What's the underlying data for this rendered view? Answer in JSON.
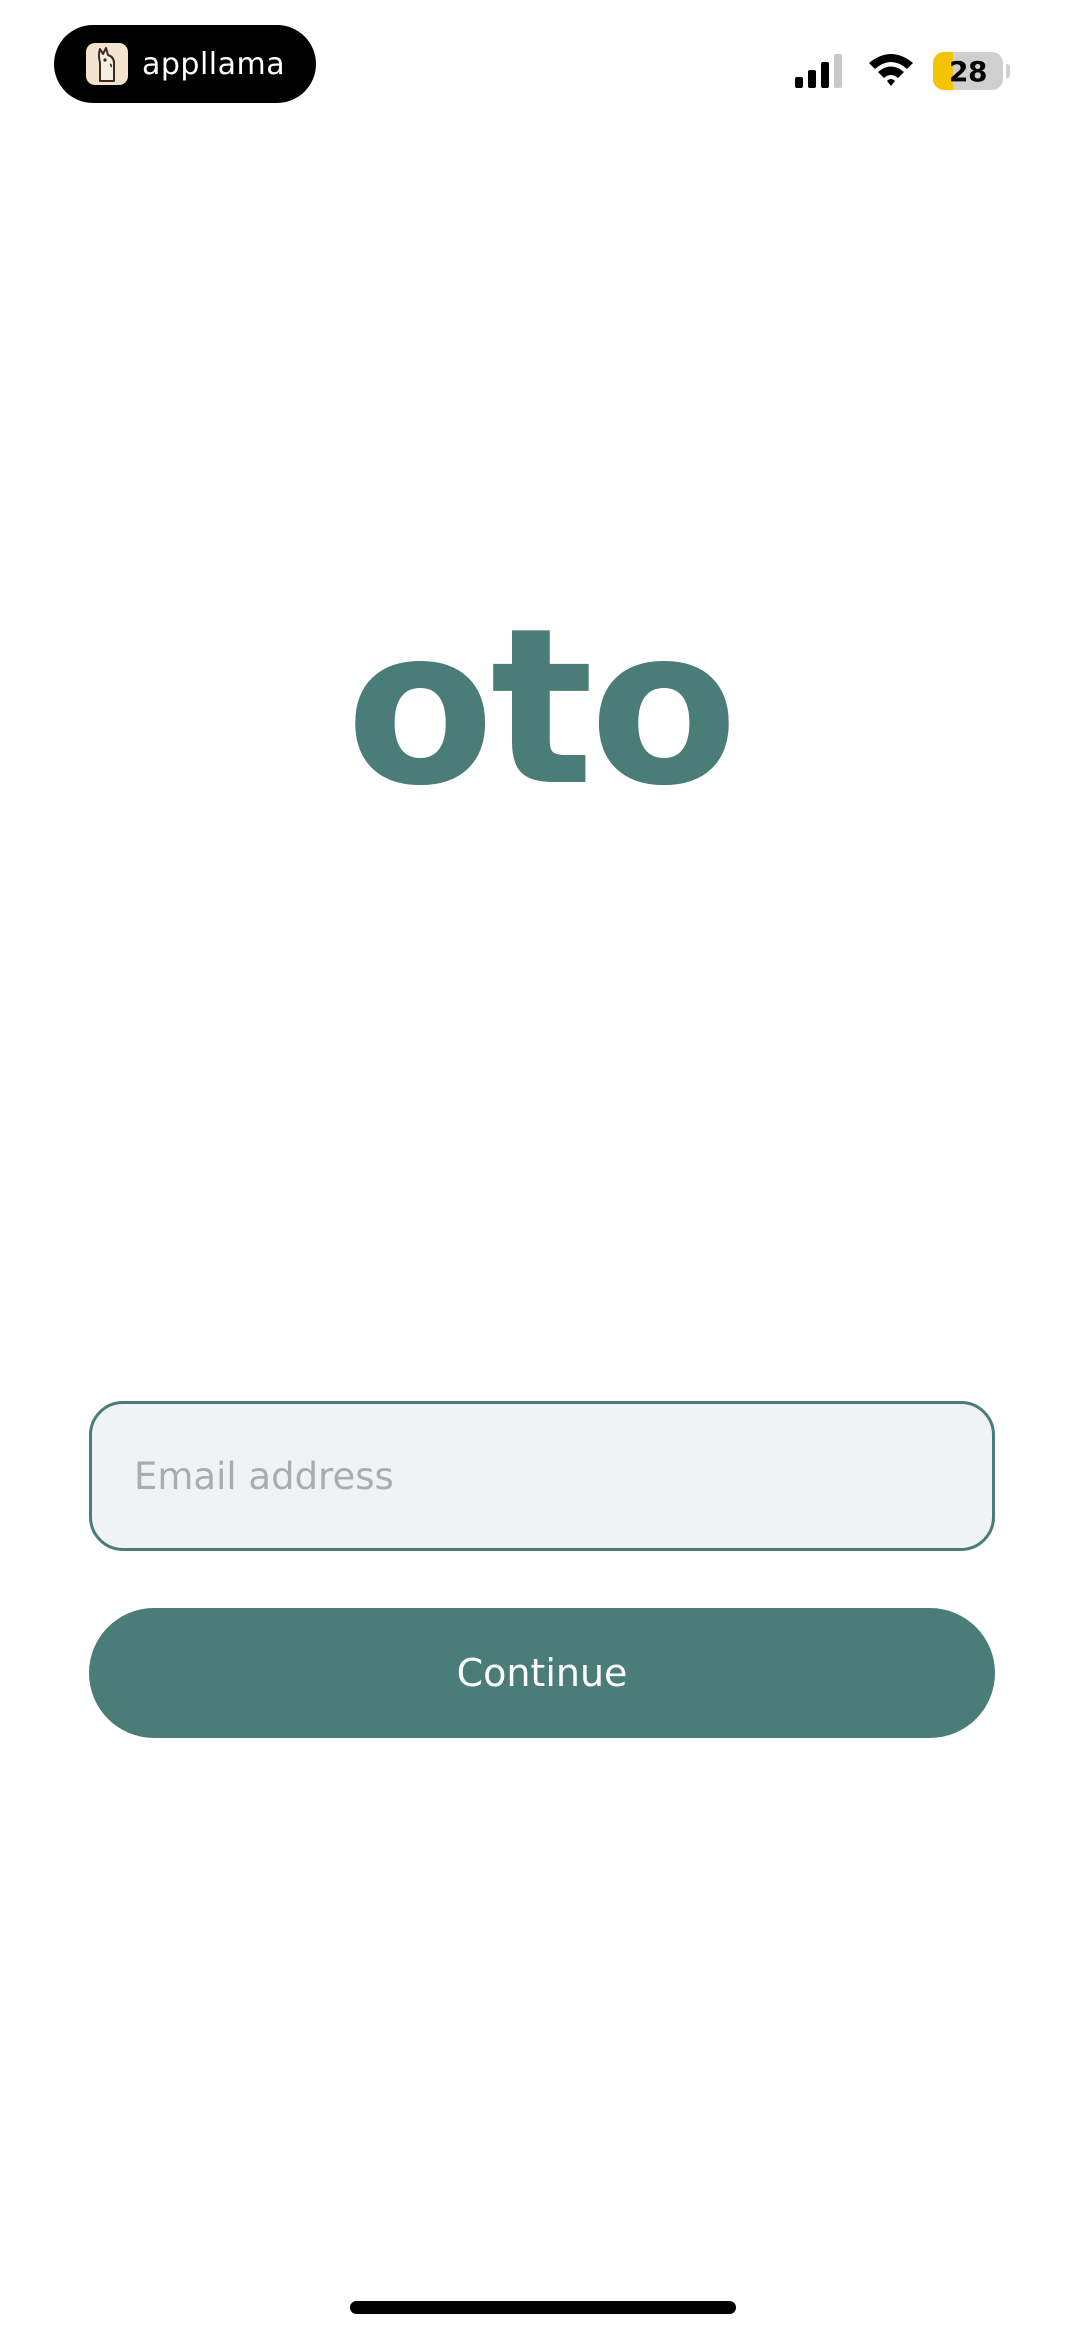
{
  "status_bar": {
    "app_pill_label": "appllama",
    "battery_level": "28",
    "battery_fraction": 0.28,
    "icons": [
      "llama-icon",
      "cellular-signal-icon",
      "wifi-icon",
      "battery-icon"
    ]
  },
  "brand": {
    "logo_text": "oto",
    "accent_color": "#4a7c78"
  },
  "login": {
    "email_placeholder": "Email address",
    "email_value": "",
    "continue_label": "Continue"
  }
}
